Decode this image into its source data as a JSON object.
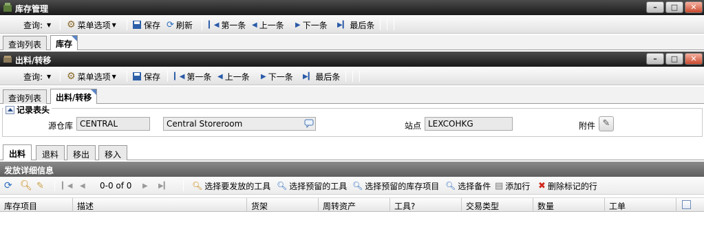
{
  "outer_window": {
    "title": "库存管理",
    "toolbar": {
      "query_label": "查询:",
      "menu_options": "菜单选项",
      "save": "保存",
      "refresh": "刷新",
      "first": "第一条",
      "prev": "上一条",
      "next": "下一条",
      "last": "最后条"
    },
    "tabs": [
      "查询列表",
      "库存"
    ]
  },
  "inner_window": {
    "title": "出料/转移",
    "toolbar": {
      "query_label": "查询:",
      "menu_options": "菜单选项",
      "save": "保存",
      "first": "第一条",
      "prev": "上一条",
      "next": "下一条",
      "last": "最后条"
    },
    "tabs": [
      "查询列表",
      "出料/转移"
    ]
  },
  "record_header": {
    "section_title": "记录表头",
    "source_store_label": "源仓库",
    "source_store_value": "CENTRAL",
    "source_store_desc": "Central Storeroom",
    "site_label": "站点",
    "site_value": "LEXCOHKG",
    "attachment_label": "附件"
  },
  "sub_tabs": [
    "出料",
    "退料",
    "移出",
    "移入"
  ],
  "details": {
    "title": "发放详细信息",
    "pager": "0-0 of 0",
    "actions": {
      "select_tools_to_issue": "选择要发放的工具",
      "select_reserved_tools": "选择预留的工具",
      "select_reserved_items": "选择预留的库存项目",
      "select_spare": "选择备件",
      "add_row": "添加行",
      "delete_marked": "删除标记的行"
    },
    "columns": [
      "库存项目",
      "描述",
      "货架",
      "周转资产",
      "工具?",
      "交易类型",
      "数量",
      "工单"
    ]
  },
  "colors": {
    "titlebar": "#2a2a2a",
    "tab_corner": "#5b84c4",
    "delete_x": "#d0291c",
    "search": "#c8860a"
  }
}
